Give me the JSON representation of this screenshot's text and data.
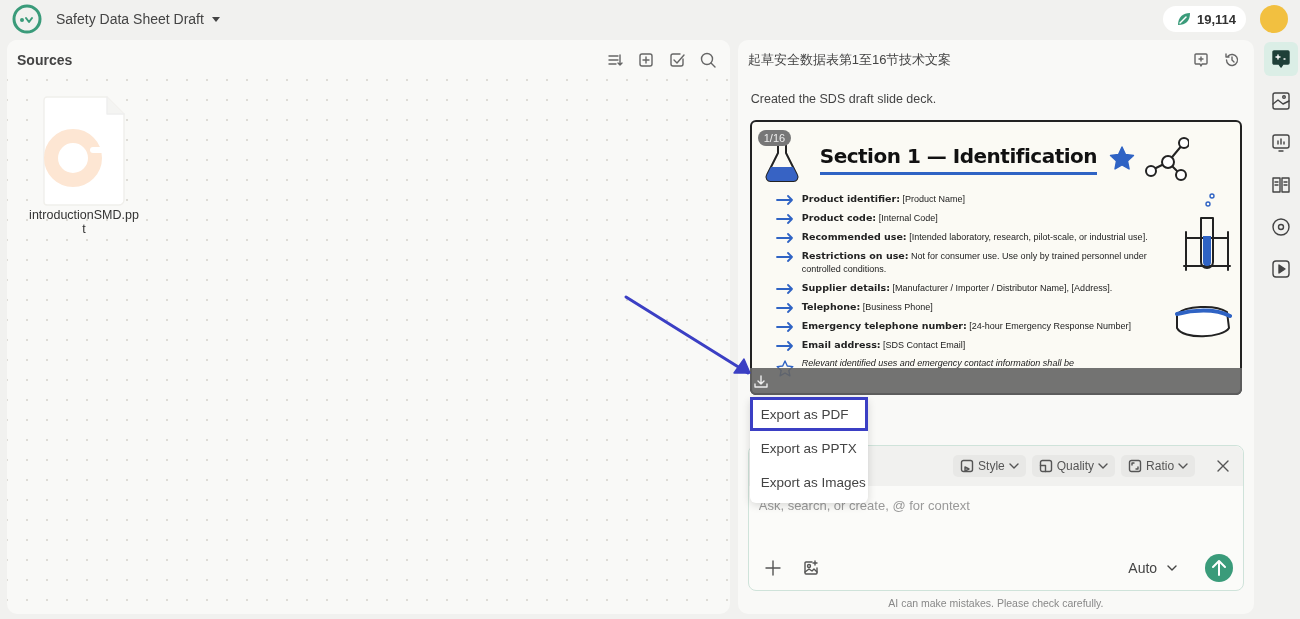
{
  "header": {
    "title": "Safety Data Sheet Draft",
    "credits": "19,114"
  },
  "sources": {
    "title": "Sources",
    "files": [
      {
        "name": "introductionSMD.ppt"
      }
    ]
  },
  "chat": {
    "title": "起草安全数据表第1至16节技术文案",
    "message": "Created the SDS draft slide deck.",
    "slide": {
      "counter": "1/16",
      "title": "Section 1 — Identification",
      "rows": [
        {
          "kind": "arrow",
          "label": "Product identifier:",
          "value": "[Product Name]"
        },
        {
          "kind": "arrow",
          "label": "Product code:",
          "value": "[Internal Code]"
        },
        {
          "kind": "arrow",
          "label": "Recommended use:",
          "value": "[Intended laboratory, research, pilot-scale, or industrial use]."
        },
        {
          "kind": "arrow",
          "label": "Restrictions on use:",
          "value": "Not for consumer use. Use only by trained personnel under controlled conditions."
        },
        {
          "kind": "arrow",
          "label": "Supplier details:",
          "value": "[Manufacturer / Importer / Distributor Name], [Address]."
        },
        {
          "kind": "arrow",
          "label": "Telephone:",
          "value": "[Business Phone]"
        },
        {
          "kind": "arrow",
          "label": "Emergency telephone number:",
          "value": "[24-hour Emergency Response Number]"
        },
        {
          "kind": "arrow",
          "label": "Email address:",
          "value": "[SDS Contact Email]"
        },
        {
          "kind": "star",
          "label": "",
          "value": "Relevant identified uses and emergency contact information shall be"
        }
      ]
    },
    "export_menu": [
      {
        "label": "Export as PDF",
        "selected": true
      },
      {
        "label": "Export as PPTX",
        "selected": false
      },
      {
        "label": "Export as Images",
        "selected": false
      }
    ],
    "composer": {
      "chips": [
        {
          "label": "Style"
        },
        {
          "label": "Quality"
        },
        {
          "label": "Ratio"
        }
      ],
      "placeholder": "Ask, search, or create, @ for context",
      "model": "Auto"
    },
    "disclaimer": "AI can make mistakes. Please check carefully."
  },
  "rail": [
    {
      "selected": true
    },
    {
      "selected": false
    },
    {
      "selected": false
    },
    {
      "selected": false
    },
    {
      "selected": false
    },
    {
      "selected": false
    }
  ]
}
